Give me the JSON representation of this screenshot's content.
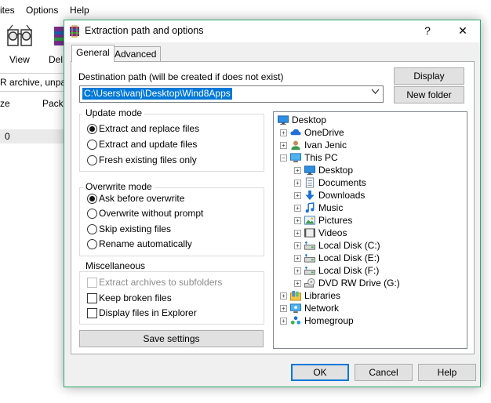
{
  "background_app": {
    "menu": [
      "ites",
      "Options",
      "Help"
    ],
    "toolbar": [
      {
        "label": "View",
        "icon": "view-icon"
      },
      {
        "label": "Del",
        "icon": "delete-icon"
      }
    ],
    "path_text": "R archive, unpac",
    "columns": [
      "ze",
      "Pack"
    ],
    "row_value": "0"
  },
  "dialog": {
    "title": "Extraction path and options",
    "help_button": "?",
    "close_button": "✕",
    "tabs": [
      {
        "label": "General",
        "active": true
      },
      {
        "label": "Advanced",
        "active": false
      }
    ],
    "destination": {
      "label": "Destination path (will be created if does not exist)",
      "value": "C:\\Users\\ivanj\\Desktop\\Wind8Apps"
    },
    "side_buttons": {
      "display": "Display",
      "new_folder": "New folder"
    },
    "update_mode": {
      "title": "Update mode",
      "options": [
        {
          "label": "Extract and replace files",
          "selected": true
        },
        {
          "label": "Extract and update files",
          "selected": false
        },
        {
          "label": "Fresh existing files only",
          "selected": false
        }
      ]
    },
    "overwrite_mode": {
      "title": "Overwrite mode",
      "options": [
        {
          "label": "Ask before overwrite",
          "selected": true
        },
        {
          "label": "Overwrite without prompt",
          "selected": false
        },
        {
          "label": "Skip existing files",
          "selected": false
        },
        {
          "label": "Rename automatically",
          "selected": false
        }
      ]
    },
    "miscellaneous": {
      "title": "Miscellaneous",
      "options": [
        {
          "label": "Extract archives to subfolders",
          "checked": false,
          "disabled": true
        },
        {
          "label": "Keep broken files",
          "checked": false,
          "disabled": false
        },
        {
          "label": "Display files in Explorer",
          "checked": false,
          "disabled": false
        }
      ]
    },
    "save_settings": "Save settings",
    "tree": [
      {
        "label": "Desktop",
        "icon": "desktop-icon",
        "level": 0,
        "expander": ""
      },
      {
        "label": "OneDrive",
        "icon": "cloud-icon",
        "level": 1,
        "expander": "+"
      },
      {
        "label": "Ivan Jenic",
        "icon": "user-icon",
        "level": 1,
        "expander": "+"
      },
      {
        "label": "This PC",
        "icon": "computer-icon",
        "level": 1,
        "expander": "−"
      },
      {
        "label": "Desktop",
        "icon": "desktop-icon",
        "level": 2,
        "expander": "+"
      },
      {
        "label": "Documents",
        "icon": "documents-icon",
        "level": 2,
        "expander": "+"
      },
      {
        "label": "Downloads",
        "icon": "download-icon",
        "level": 2,
        "expander": "+"
      },
      {
        "label": "Music",
        "icon": "music-icon",
        "level": 2,
        "expander": "+"
      },
      {
        "label": "Pictures",
        "icon": "pictures-icon",
        "level": 2,
        "expander": "+"
      },
      {
        "label": "Videos",
        "icon": "videos-icon",
        "level": 2,
        "expander": "+"
      },
      {
        "label": "Local Disk (C:)",
        "icon": "disk-icon",
        "level": 2,
        "expander": "+"
      },
      {
        "label": "Local Disk (E:)",
        "icon": "disk-icon",
        "level": 2,
        "expander": "+"
      },
      {
        "label": "Local Disk (F:)",
        "icon": "disk-icon",
        "level": 2,
        "expander": "+"
      },
      {
        "label": "DVD RW Drive (G:)",
        "icon": "dvd-icon",
        "level": 2,
        "expander": "+"
      },
      {
        "label": "Libraries",
        "icon": "libraries-icon",
        "level": 1,
        "expander": "+"
      },
      {
        "label": "Network",
        "icon": "network-icon",
        "level": 1,
        "expander": "+"
      },
      {
        "label": "Homegroup",
        "icon": "homegroup-icon",
        "level": 1,
        "expander": "+"
      }
    ],
    "footer": {
      "ok": "OK",
      "cancel": "Cancel",
      "help": "Help"
    },
    "colors": {
      "accent_border": "#2dab6f",
      "selection": "#0078d7"
    }
  }
}
